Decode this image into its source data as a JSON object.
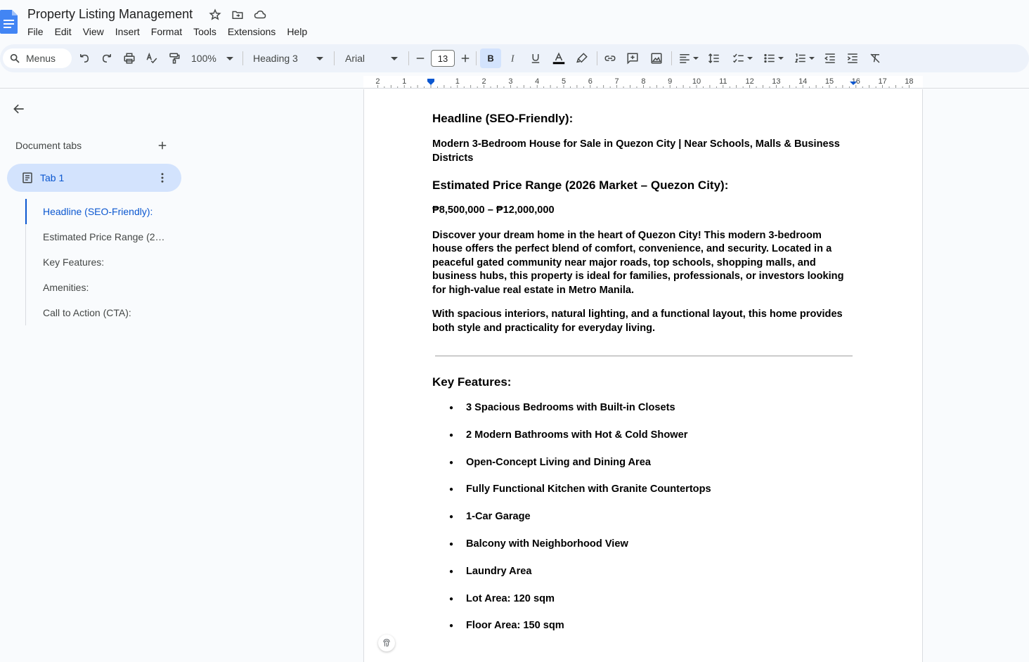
{
  "app": {
    "title": "Property Listing Management",
    "menu": [
      "File",
      "Edit",
      "View",
      "Insert",
      "Format",
      "Tools",
      "Extensions",
      "Help"
    ]
  },
  "toolbar": {
    "search_label": "Menus",
    "zoom": "100%",
    "style": "Heading 3",
    "font": "Arial",
    "font_size": "13"
  },
  "ruler": {
    "marks": [
      "2",
      "1",
      "1",
      "2",
      "3",
      "4",
      "5",
      "6",
      "7",
      "8",
      "9",
      "10",
      "11",
      "12",
      "13",
      "14",
      "15",
      "16",
      "17",
      "18"
    ]
  },
  "sidebar": {
    "heading": "Document tabs",
    "tab_label": "Tab 1",
    "outline": [
      "Headline (SEO-Friendly):",
      "Estimated Price Range (2…",
      "Key Features:",
      "Amenities:",
      "Call to Action (CTA):"
    ]
  },
  "document": {
    "h_headline": "Headline (SEO-Friendly):",
    "headline_text": "Modern 3-Bedroom House for Sale in Quezon City | Near Schools, Malls & Business Districts",
    "h_price": "Estimated Price Range (2026 Market – Quezon City):",
    "price_text": "₱8,500,000 – ₱12,000,000",
    "para1": "Discover your dream home in the heart of Quezon City! This modern 3-bedroom house offers the perfect blend of comfort, convenience, and security. Located in a peaceful gated community near major roads, top schools, shopping malls, and business hubs, this property is ideal for families, professionals, or investors looking for high-value real estate in Metro Manila.",
    "para2": "With spacious interiors, natural lighting, and a functional layout, this home provides both style and practicality for everyday living.",
    "h_features": "Key Features:",
    "features": [
      "3 Spacious Bedrooms with Built-in Closets",
      "2 Modern Bathrooms with Hot & Cold Shower",
      "Open-Concept Living and Dining Area",
      "Fully Functional Kitchen with Granite Countertops",
      "1-Car Garage",
      "Balcony with Neighborhood View",
      "Laundry Area",
      "Lot Area: 120 sqm",
      "Floor Area: 150 sqm"
    ]
  },
  "colors": {
    "accent": "#0b57d0",
    "tab_bg": "#d3e3fd",
    "toolbar_bg": "#edf2fa",
    "app_bg": "#f9fbfd",
    "docs_blue": "#4285f4"
  }
}
